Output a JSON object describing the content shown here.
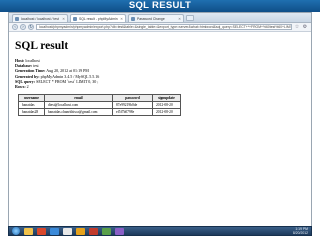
{
  "slide": {
    "title": "SQL RESULT"
  },
  "browser": {
    "tabs": [
      {
        "label": "localhost / localhost / test | ...",
        "active": false
      },
      {
        "label": "SQL result - phpMyAdmin",
        "active": true
      },
      {
        "label": "Password Change",
        "active": false
      }
    ],
    "address": "localhost/phpmyadmin/phpmyadmin/export.php?db=test&table=&single_table=&export_type=server&what=htmlword&sql_query=SELECT+*+FROM+%60test%60+LIMIT+0%2C+30"
  },
  "page": {
    "heading": "SQL result",
    "meta": [
      {
        "key": "Host:",
        "value": "localhost"
      },
      {
        "key": "Database:",
        "value": "test"
      },
      {
        "key": "Generation Time:",
        "value": "Aug 20, 2012 at 01:19 PM"
      },
      {
        "key": "Generated by:",
        "value": "phpMyAdmin 3.4.5 / MySQL 5.5.16"
      },
      {
        "key": "SQL query:",
        "value": "SELECT * FROM `test` LIMIT 0, 30 ;"
      },
      {
        "key": "Rows:",
        "value": "2"
      }
    ]
  },
  "table": {
    "headers": [
      "username",
      "email",
      "password",
      "signupdate"
    ],
    "rows": [
      [
        "banatdas",
        "dtest@localhost.com",
        "87e99219b0de",
        "2012-08-20"
      ],
      [
        "banatdas28",
        "banatdas.chanrithisca@gmail.com",
        "ef5f7b0798e",
        "2012-08-20"
      ]
    ]
  },
  "taskbar": {
    "app_colors": [
      "#f1c24b",
      "#d9472b",
      "#3b8ad9",
      "#e8e8e8",
      "#e6a21c",
      "#c23b2b",
      "#5aa04a",
      "#8a5fc6"
    ],
    "clock_time": "1:19 PM",
    "clock_date": "8/20/2012"
  }
}
